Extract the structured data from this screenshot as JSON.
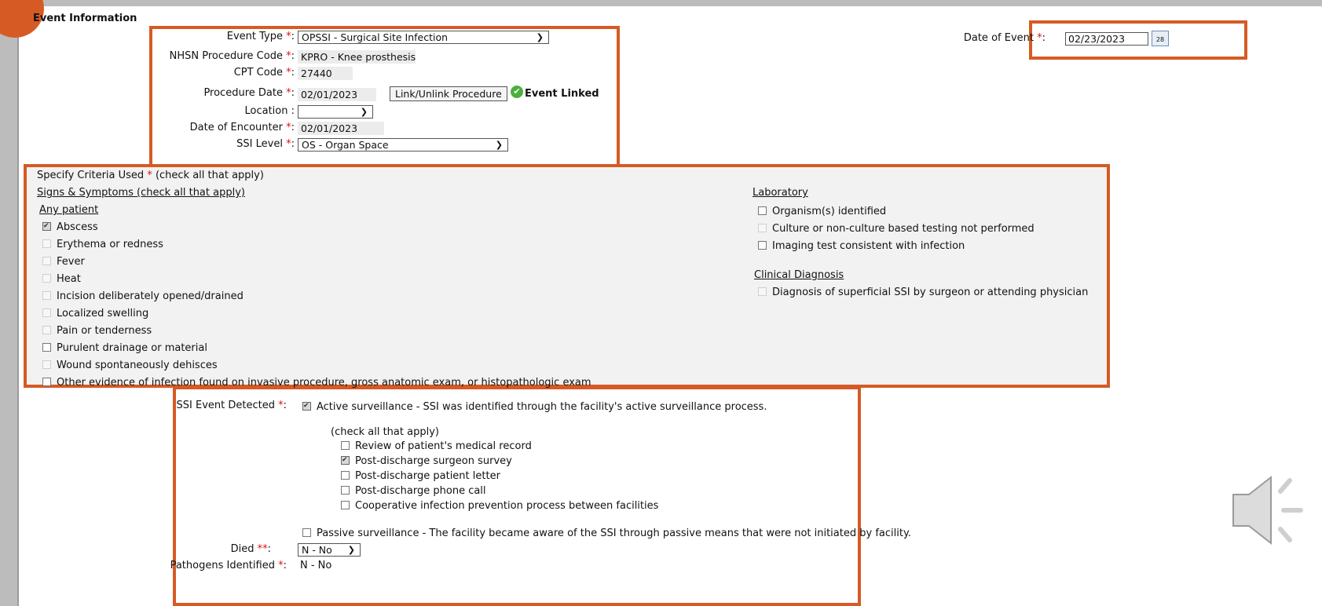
{
  "section_title": "Event Information",
  "event_type": {
    "label": "Event Type",
    "required": "*",
    "value": "OPSSI - Surgical Site Infection"
  },
  "procedure_code": {
    "label": "NHSN Procedure Code",
    "required": "*",
    "value": "KPRO - Knee prosthesis"
  },
  "cpt_code": {
    "label": "CPT Code",
    "required": "*",
    "value": "27440"
  },
  "procedure_date": {
    "label": "Procedure Date",
    "required": "*",
    "value": "02/01/2023",
    "link_button": "Link/Unlink Procedure",
    "linked_status": "Event Linked"
  },
  "location": {
    "label": "Location",
    "value": ""
  },
  "date_of_encounter": {
    "label": "Date of Encounter",
    "required": "*",
    "value": "02/01/2023"
  },
  "ssi_level": {
    "label": "SSI Level",
    "required": "*",
    "value": "OS - Organ Space"
  },
  "date_of_event": {
    "label": "Date of Event",
    "required": "*",
    "value": "02/23/2023",
    "calendar_icon_text": "28"
  },
  "criteria": {
    "title": "Specify Criteria Used",
    "required": "*",
    "title_note": "(check all that apply)",
    "signs_heading": "Signs & Symptoms (check all that apply)",
    "any_patient_heading": "Any patient",
    "signs": [
      {
        "label": "Abscess",
        "checked": true,
        "disabled": false
      },
      {
        "label": "Erythema or redness",
        "checked": false,
        "disabled": true
      },
      {
        "label": "Fever",
        "checked": false,
        "disabled": true
      },
      {
        "label": "Heat",
        "checked": false,
        "disabled": true
      },
      {
        "label": "Incision deliberately opened/drained",
        "checked": false,
        "disabled": true
      },
      {
        "label": "Localized swelling",
        "checked": false,
        "disabled": true
      },
      {
        "label": "Pain or tenderness",
        "checked": false,
        "disabled": true
      },
      {
        "label": "Purulent drainage or material",
        "checked": false,
        "disabled": false
      },
      {
        "label": "Wound spontaneously dehisces",
        "checked": false,
        "disabled": true
      },
      {
        "label": "Other evidence of infection found on invasive procedure, gross anatomic exam, or histopathologic exam",
        "checked": false,
        "disabled": false
      }
    ],
    "lab_heading": "Laboratory",
    "lab": [
      {
        "label": "Organism(s) identified",
        "checked": false,
        "disabled": false
      },
      {
        "label": "Culture or non-culture based testing not performed",
        "checked": false,
        "disabled": true
      },
      {
        "label": "Imaging test consistent with infection",
        "checked": false,
        "disabled": false
      }
    ],
    "clinical_heading": "Clinical Diagnosis",
    "clinical": [
      {
        "label": "Diagnosis of superficial SSI by surgeon or attending physician",
        "checked": false,
        "disabled": true
      }
    ]
  },
  "detection": {
    "label": "SSI Event Detected",
    "required": "*",
    "active": "Active surveillance - SSI was identified through the facility's active surveillance process.",
    "active_checked": true,
    "sub_note": "(check all that apply)",
    "sub_items": [
      {
        "label": "Review of patient's medical record",
        "checked": false
      },
      {
        "label": "Post-discharge surgeon survey",
        "checked": true
      },
      {
        "label": "Post-discharge patient letter",
        "checked": false
      },
      {
        "label": "Post-discharge phone call",
        "checked": false
      },
      {
        "label": "Cooperative infection prevention process between facilities",
        "checked": false
      }
    ],
    "passive": "Passive surveillance - The facility became aware of the SSI through passive means that were not initiated by facility.",
    "passive_checked": false
  },
  "died": {
    "label": "Died",
    "required": "**",
    "value": "N - No"
  },
  "pathogens": {
    "label": "Pathogens Identified",
    "required": "*",
    "value": "N - No"
  },
  "colors": {
    "accent": "#d65a24",
    "required": "#e01010",
    "panel": "#f2f2f2"
  }
}
